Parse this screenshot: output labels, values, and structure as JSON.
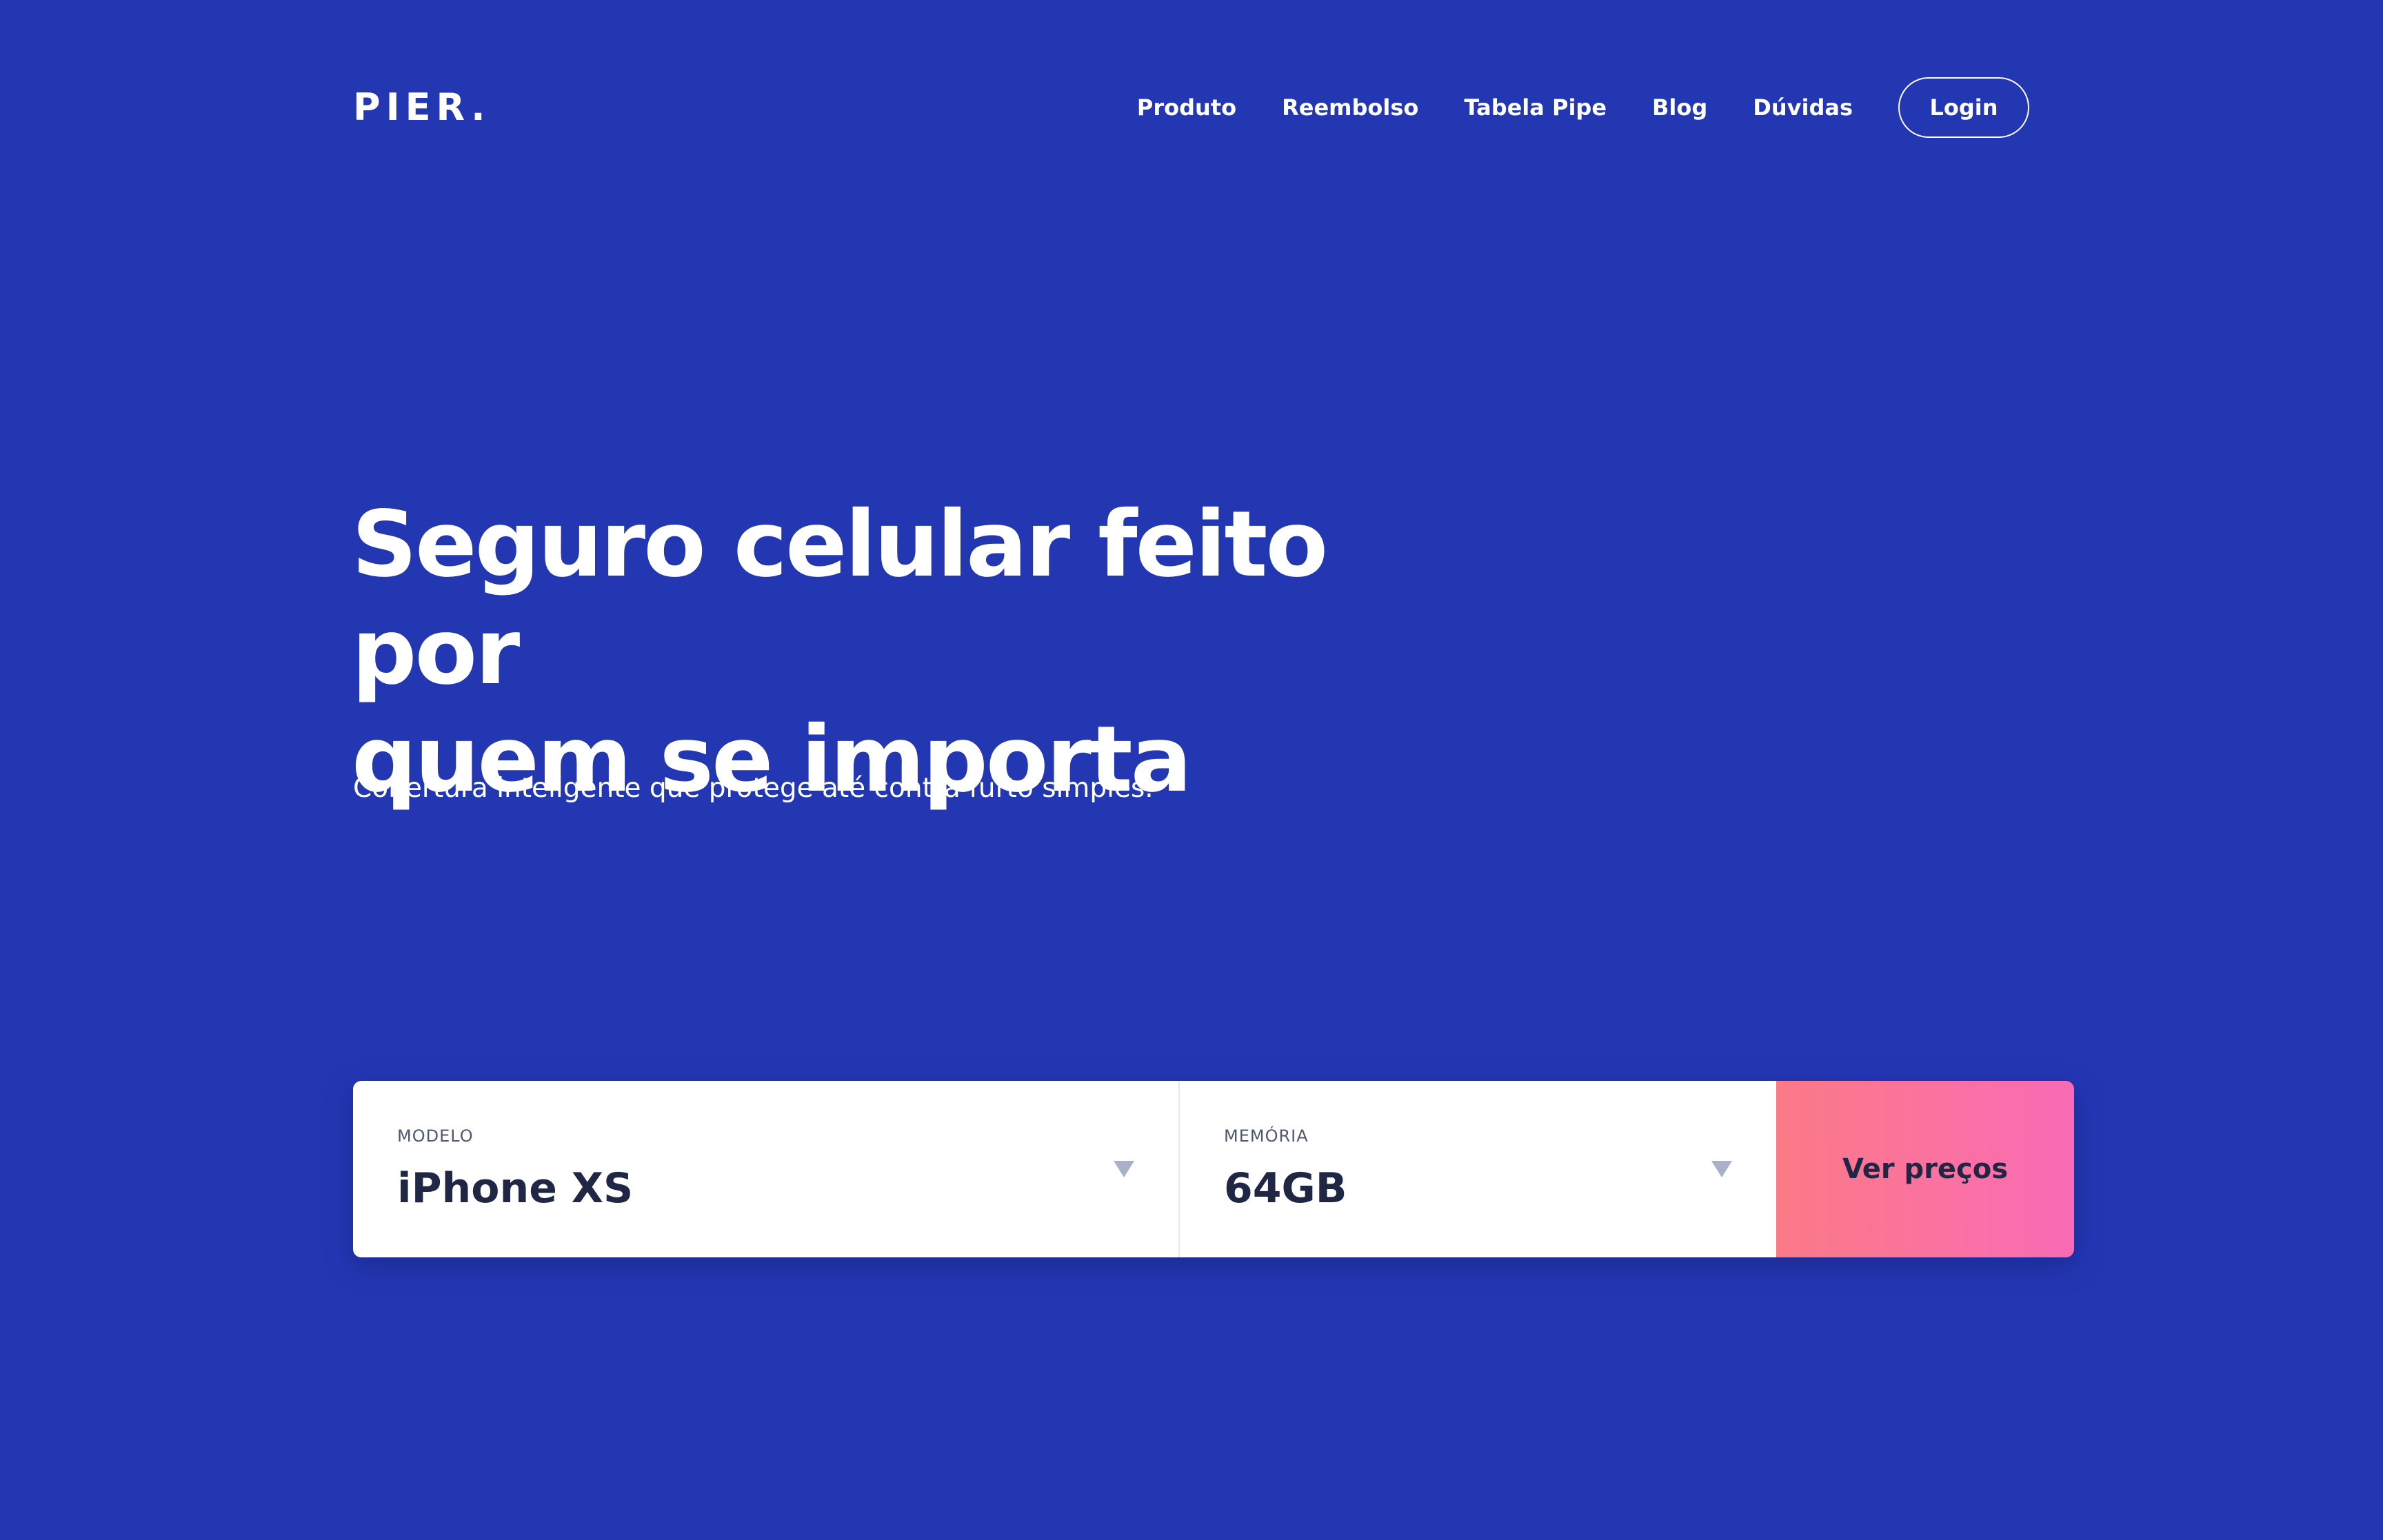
{
  "colors": {
    "background": "#2437b3",
    "text": "#ffffff",
    "field_text": "#1f2745",
    "field_label": "#4f5872",
    "cta_gradient_start": "#fb7a86",
    "cta_gradient_end": "#f96bb6"
  },
  "header": {
    "logo": "PIER.",
    "nav": [
      "Produto",
      "Reembolso",
      "Tabela Pipe",
      "Blog",
      "Dúvidas"
    ],
    "login_label": "Login"
  },
  "hero": {
    "title_line1": "Seguro celular feito por",
    "title_line2": "quem se importa",
    "subtitle": "Cobertura inteligente que protege até contra furto simples."
  },
  "search": {
    "model_label": "MODELO",
    "model_value": "iPhone XS",
    "memory_label": "MEMÓRIA",
    "memory_value": "64GB",
    "submit_label": "Ver preços",
    "chevron_icon": "chevron-down-icon"
  }
}
